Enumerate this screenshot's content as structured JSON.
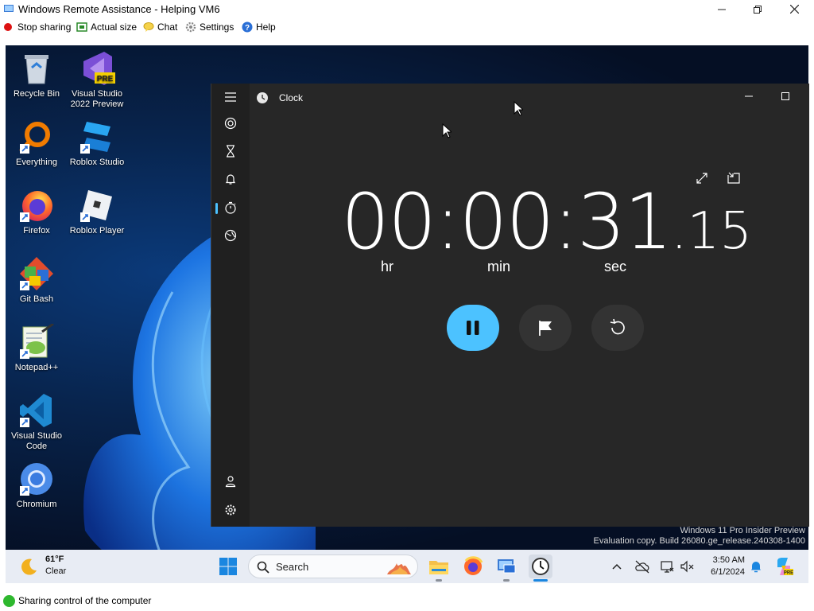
{
  "window": {
    "title": "Windows Remote Assistance - Helping VM6"
  },
  "toolbar": {
    "stop_sharing": "Stop sharing",
    "actual_size": "Actual size",
    "chat": "Chat",
    "settings": "Settings",
    "help": "Help"
  },
  "desktop_icons": [
    {
      "label": "Recycle Bin"
    },
    {
      "label": "Visual Studio 2022 Preview",
      "badge": "PRE"
    },
    {
      "label": "Everything"
    },
    {
      "label": "Roblox Studio"
    },
    {
      "label": "Firefox"
    },
    {
      "label": "Roblox Player"
    },
    {
      "label": "Git Bash"
    },
    {
      "label": "Notepad++"
    },
    {
      "label": "Visual Studio Code"
    },
    {
      "label": "Chromium"
    }
  ],
  "clock": {
    "title": "Clock",
    "stopwatch": {
      "hours": "00",
      "minutes": "00",
      "seconds": "31",
      "hundredths": "15",
      "hr_label": "hr",
      "min_label": "min",
      "sec_label": "sec"
    },
    "sidebar_selected": "stopwatch"
  },
  "watermark": {
    "line1": "Windows 11 Pro Insider Preview",
    "line2": "Evaluation copy. Build 26080.ge_release.240308-1400"
  },
  "taskbar": {
    "weather_temp": "61°F",
    "weather_cond": "Clear",
    "search_label": "Search",
    "time": "3:50 AM",
    "date": "6/1/2024"
  },
  "status": {
    "text": "Sharing control of the computer"
  },
  "colors": {
    "accent": "#4cc2ff",
    "status_green": "#2eb82e",
    "stop_red": "#d11"
  }
}
